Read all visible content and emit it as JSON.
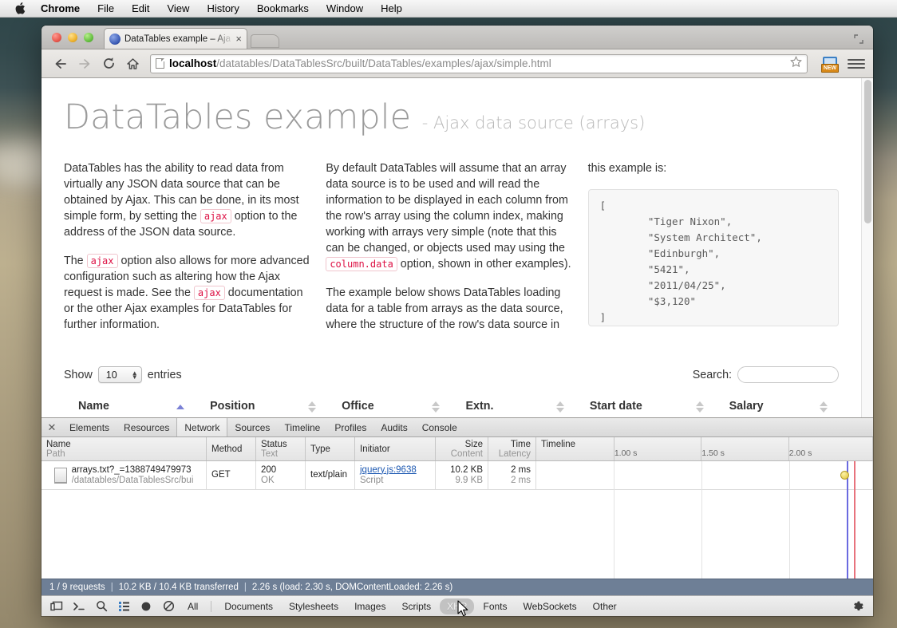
{
  "menubar": {
    "apple_icon": "apple-logo",
    "items": [
      {
        "label": "Chrome",
        "bold": true
      },
      {
        "label": "File",
        "bold": false
      },
      {
        "label": "Edit",
        "bold": false
      },
      {
        "label": "View",
        "bold": false
      },
      {
        "label": "History",
        "bold": false
      },
      {
        "label": "Bookmarks",
        "bold": false
      },
      {
        "label": "Window",
        "bold": false
      },
      {
        "label": "Help",
        "bold": false
      }
    ]
  },
  "browser": {
    "tab_title": "DataTables example – Aja",
    "tab_close": "×",
    "url_host": "localhost",
    "url_path": "/datatables/DataTablesSrc/built/DataTables/examples/ajax/simple.html",
    "star_icon": "star-icon",
    "extension_badge": "NEW",
    "back_icon": "back-arrow-icon",
    "forward_icon": "forward-arrow-icon",
    "reload_icon": "reload-icon",
    "home_icon": "home-icon",
    "menu_icon": "hamburger-menu-icon"
  },
  "page": {
    "title": "DataTables example",
    "subtitle": "- Ajax data source (arrays)",
    "col1_p1_a": "DataTables has the ability to read data from virtually any JSON data source that can be obtained by Ajax. This can be done, in its most simple form, by setting the ",
    "col1_p1_code": "ajax",
    "col1_p1_b": " option to the address of the JSON data source.",
    "col1_p2_a": "The ",
    "col1_p2_code1": "ajax",
    "col1_p2_b": " option also allows for more advanced configuration such as altering how the Ajax request is made. See the ",
    "col1_p2_code2": "ajax",
    "col1_p2_c": " documentation or the other Ajax examples for DataTables for further information.",
    "col2_p1_a": "By default DataTables will assume that an array data source is to be used and will read the information to be displayed in each column from the row's array using the column index, making working with arrays very simple (note that this can be changed, or objects used may using the ",
    "col2_p1_code": "column.data",
    "col2_p1_b": " option, shown in other examples).",
    "col2_p2": "The example below shows DataTables loading data for a table from arrays as the data source, where the structure of the row's data source in",
    "col3_lead": "this example is:",
    "col3_code": "[\n        \"Tiger Nixon\",\n        \"System Architect\",\n        \"Edinburgh\",\n        \"5421\",\n        \"2011/04/25\",\n        \"$3,120\"\n]"
  },
  "datatable": {
    "show_label": "Show",
    "length_value": "10",
    "entries_label": "entries",
    "search_label": "Search:",
    "search_value": "",
    "search_placeholder": "",
    "columns": [
      {
        "label": "Name",
        "sorted": true,
        "direction": "asc"
      },
      {
        "label": "Position",
        "sorted": false,
        "direction": ""
      },
      {
        "label": "Office",
        "sorted": false,
        "direction": ""
      },
      {
        "label": "Extn.",
        "sorted": false,
        "direction": ""
      },
      {
        "label": "Start date",
        "sorted": false,
        "direction": ""
      },
      {
        "label": "Salary",
        "sorted": false,
        "direction": ""
      }
    ]
  },
  "devtools": {
    "close_icon": "close-icon",
    "tabs": [
      {
        "label": "Elements",
        "active": false
      },
      {
        "label": "Resources",
        "active": false
      },
      {
        "label": "Network",
        "active": true
      },
      {
        "label": "Sources",
        "active": false
      },
      {
        "label": "Timeline",
        "active": false
      },
      {
        "label": "Profiles",
        "active": false
      },
      {
        "label": "Audits",
        "active": false
      },
      {
        "label": "Console",
        "active": false
      }
    ],
    "network_headers": {
      "name": "Name",
      "name_sub": "Path",
      "method": "Method",
      "status": "Status",
      "status_sub": "Text",
      "type": "Type",
      "initiator": "Initiator",
      "size": "Size",
      "size_sub": "Content",
      "time": "Time",
      "time_sub": "Latency",
      "timeline": "Timeline"
    },
    "timeline_ticks": [
      "1.00 s",
      "1.50 s",
      "2.00 s"
    ],
    "rows": [
      {
        "name": "arrays.txt?_=1388749479973",
        "path": "/datatables/DataTablesSrc/bui",
        "method": "GET",
        "status": "200",
        "status_text": "OK",
        "type": "text/plain",
        "initiator": "jquery.js:9638",
        "initiator_sub": "Script",
        "size": "10.2 KB",
        "size_sub": "9.9 KB",
        "time": "2 ms",
        "time_sub": "2 ms"
      }
    ],
    "status_bar": {
      "requests": "1 / 9 requests",
      "transferred": "10.2 KB / 10.4 KB transferred",
      "timing": "2.26 s (load: 2.30 s, DOMContentLoaded: 2.26 s)",
      "divider": "|"
    },
    "toolbar_icons": [
      {
        "name": "dock-panel-icon"
      },
      {
        "name": "console-drawer-icon"
      },
      {
        "name": "search-icon"
      },
      {
        "name": "filter-list-icon"
      },
      {
        "name": "record-icon"
      },
      {
        "name": "clear-icon"
      }
    ],
    "filters": [
      {
        "label": "All",
        "active": false
      },
      {
        "label": "Documents",
        "active": false
      },
      {
        "label": "Stylesheets",
        "active": false
      },
      {
        "label": "Images",
        "active": false
      },
      {
        "label": "Scripts",
        "active": false
      },
      {
        "label": "XHR",
        "active": true
      },
      {
        "label": "Fonts",
        "active": false
      },
      {
        "label": "WebSockets",
        "active": false
      },
      {
        "label": "Other",
        "active": false
      }
    ],
    "settings_icon": "gear-icon"
  },
  "colors": {
    "accent_sort": "#7b81d6",
    "status_bar_bg": "#6e7f96",
    "code_text": "#d14",
    "link": "#1b57b1"
  }
}
